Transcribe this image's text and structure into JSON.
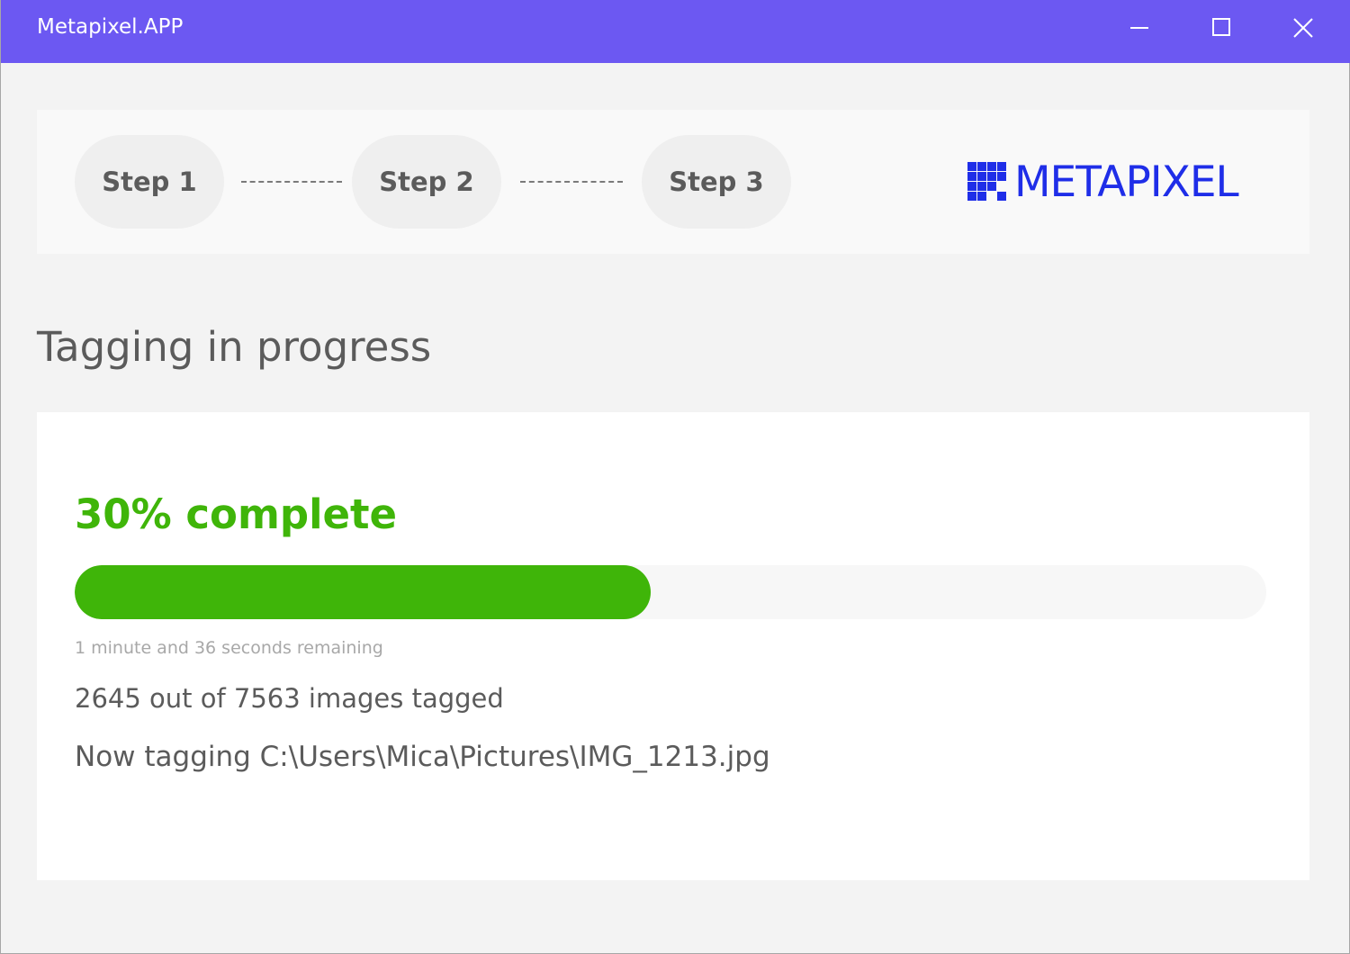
{
  "window": {
    "title": "Metapixel.APP",
    "controls": {
      "minimize_icon": "minimize-icon",
      "maximize_icon": "maximize-icon",
      "close_icon": "close-icon"
    },
    "accent_color": "#6c58f2"
  },
  "steps": [
    {
      "label": "Step 1"
    },
    {
      "label": "Step 2"
    },
    {
      "label": "Step 3"
    }
  ],
  "logo": {
    "text": "METAPIXEL",
    "color": "#1f2ee8"
  },
  "page": {
    "heading": "Tagging in progress"
  },
  "progress": {
    "percent_label": "30% complete",
    "fraction": 0.4834,
    "color": "#3fb509",
    "remaining": "1 minute and 36 seconds remaining",
    "count_line": "2645 out of 7563 images tagged",
    "current_file_line": "Now tagging C:\\Users\\Mica\\Pictures\\IMG_1213.jpg"
  }
}
